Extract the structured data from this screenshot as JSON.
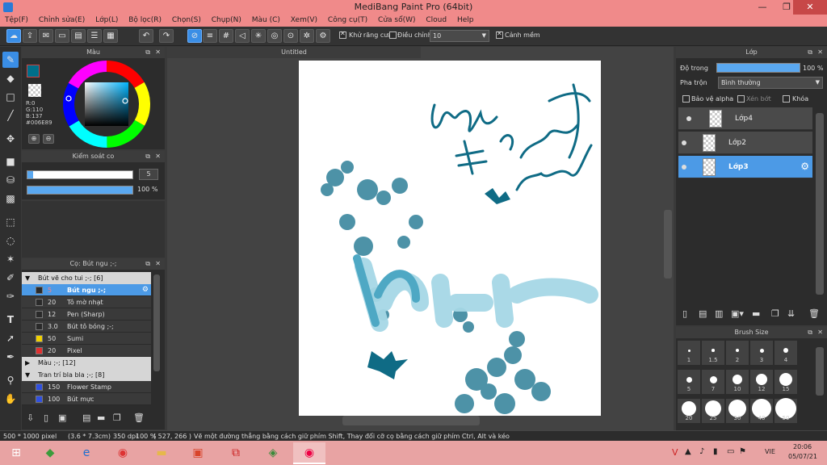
{
  "window": {
    "title": "MediBang Paint Pro (64bit)",
    "minimize": "—",
    "maximize": "❐",
    "close": "✕"
  },
  "menu": [
    "Tệp(F)",
    "Chỉnh sửa(E)",
    "Lớp(L)",
    "Bộ lọc(R)",
    "Chọn(S)",
    "Chụp(N)",
    "Màu (C)",
    "Xem(V)",
    "Công cụ(T)",
    "Cửa sổ(W)",
    "Cloud",
    "Help"
  ],
  "toolbar": {
    "antialias_label": "Khử răng cưa",
    "correction_label": "Điều chỉnh",
    "correction_value": "10",
    "warning_label": "Cảnh mềm"
  },
  "color_panel": {
    "title": "Màu",
    "r": "R:0",
    "g": "G:110",
    "b": "B:137",
    "hex": "#006E89",
    "accent": "#006E89"
  },
  "brush_control": {
    "title": "Kiểm soát co",
    "size_value": "5",
    "opacity_value": "100 %"
  },
  "brush_panel": {
    "title": "Cọ: Bút ngu ;-;",
    "groups": [
      {
        "label": "Bút vẽ cho tui ;-; [6]",
        "expanded": true
      },
      {
        "label": "Màu ;-; [12]",
        "expanded": false
      },
      {
        "label": "Tran trí bla bla ;-; [8]",
        "expanded": true
      }
    ],
    "items_group1": [
      {
        "size": "5",
        "name": "Bút ngu ;-;",
        "color": "#2a2a2a",
        "selected": true
      },
      {
        "size": "20",
        "name": "Tô mờ nhạt",
        "color": "#2a2a2a"
      },
      {
        "size": "12",
        "name": "Pen (Sharp)",
        "color": "#2a2a2a"
      },
      {
        "size": "3.0",
        "name": "Bút tô bóng ;-;",
        "color": "#2a2a2a"
      },
      {
        "size": "50",
        "name": "Sumi",
        "color": "#f0d000"
      },
      {
        "size": "20",
        "name": "Pixel",
        "color": "#e03030"
      }
    ],
    "items_group3": [
      {
        "size": "150",
        "name": "Flower Stamp",
        "color": "#3050e0"
      },
      {
        "size": "100",
        "name": "Bút mực",
        "color": "#3050e0"
      }
    ]
  },
  "canvas": {
    "tab_title": "Untitled"
  },
  "layer_panel": {
    "title": "Lớp",
    "opacity_label": "Độ trong",
    "opacity_value": "100 %",
    "opacity": 1.0,
    "blend_label": "Pha trộn",
    "blend_value": "Bình thường",
    "protect_alpha": "Bảo vệ alpha",
    "clip": "Xén bớt",
    "lock": "Khóa",
    "layers": [
      {
        "name": "Lớp4",
        "selected": false
      },
      {
        "name": "Lớp2",
        "selected": false
      },
      {
        "name": "Lớp3",
        "selected": true
      }
    ]
  },
  "brush_size": {
    "title": "Brush Size",
    "sizes": [
      "1",
      "1.5",
      "2",
      "3",
      "4",
      "5",
      "7",
      "10",
      "12",
      "15",
      "20",
      "25",
      "30",
      "40",
      "50"
    ]
  },
  "status": {
    "dimensions": "500 * 1000 pixel",
    "physical": "(3.6 * 7.3cm)",
    "dpi": "350 dpi",
    "zoom": "100 %",
    "cursor": "( 527, 266 )",
    "hint": "Vẽ một đường thẳng bằng cách giữ phím Shift, Thay đổi cỡ cọ bằng cách giữ phím Ctrl, Alt và kéo"
  },
  "taskbar": {
    "lang": "VIE",
    "time": "20:06",
    "date": "05/07/21"
  }
}
